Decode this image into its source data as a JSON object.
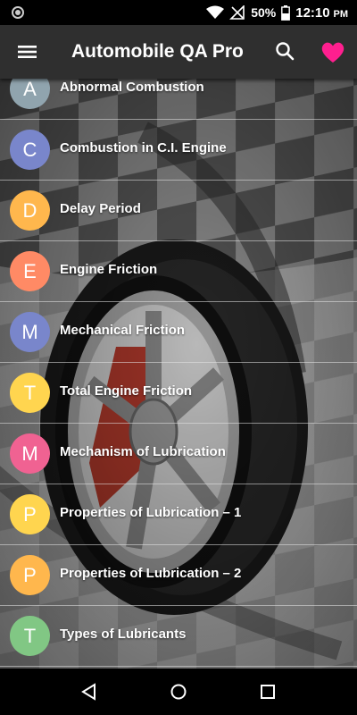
{
  "status_bar": {
    "battery": "50%",
    "time": "12:10",
    "ampm": "PM"
  },
  "app_bar": {
    "title": "Automobile QA Pro"
  },
  "list": [
    {
      "letter": "A",
      "label": "Abnormal Combustion",
      "color": "#90a4ae"
    },
    {
      "letter": "C",
      "label": "Combustion in C.I. Engine",
      "color": "#7986cb"
    },
    {
      "letter": "D",
      "label": "Delay Period",
      "color": "#ffb74d"
    },
    {
      "letter": "E",
      "label": "Engine Friction",
      "color": "#ff8a65"
    },
    {
      "letter": "M",
      "label": "Mechanical Friction",
      "color": "#7986cb"
    },
    {
      "letter": "T",
      "label": "Total Engine Friction",
      "color": "#ffd54f"
    },
    {
      "letter": "M",
      "label": "Mechanism of Lubrication",
      "color": "#f06292"
    },
    {
      "letter": "P",
      "label": "Properties of Lubrication – 1",
      "color": "#ffd54f"
    },
    {
      "letter": "P",
      "label": "Properties of Lubrication – 2",
      "color": "#ffb74d"
    },
    {
      "letter": "T",
      "label": "Types of Lubricants",
      "color": "#81c784"
    }
  ],
  "icons": {
    "menu": "hamburger-icon",
    "search": "search-icon",
    "favorite": "heart-icon",
    "nav_back": "back-triangle-icon",
    "nav_home": "home-circle-icon",
    "nav_recents": "recents-square-icon"
  },
  "colors": {
    "app_bar": "#2f2f2f",
    "heart": "#ff1f8f"
  }
}
